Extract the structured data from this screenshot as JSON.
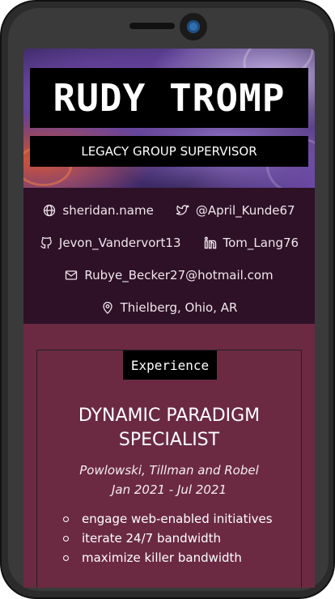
{
  "profile": {
    "name": "RUDY TROMP",
    "title": "LEGACY GROUP SUPERVISOR"
  },
  "contacts": {
    "website": {
      "text": "sheridan.name",
      "icon": "globe-icon"
    },
    "twitter": {
      "text": "@April_Kunde67",
      "icon": "twitter-icon"
    },
    "github": {
      "text": "Jevon_Vandervort13",
      "icon": "github-icon"
    },
    "linkedin": {
      "text": "Tom_Lang76",
      "icon": "linkedin-icon"
    },
    "email": {
      "text": "Rubye_Becker27@hotmail.com",
      "icon": "mail-icon"
    },
    "location": {
      "text": "Thielberg, Ohio, AR",
      "icon": "map-pin-icon"
    }
  },
  "experience": {
    "section_label": "Experience",
    "job": {
      "title": "DYNAMIC PARADIGM SPECIALIST",
      "company": "Powlowski, Tillman and Robel",
      "dates": "Jan 2021 - Jul 2021",
      "bullets": [
        "engage web-enabled initiatives",
        "iterate 24/7 bandwidth",
        "maximize killer bandwidth"
      ]
    }
  },
  "colors": {
    "content_bg": "#6b2a42",
    "contacts_bg": "#2e1126",
    "label_bg": "#000000"
  }
}
